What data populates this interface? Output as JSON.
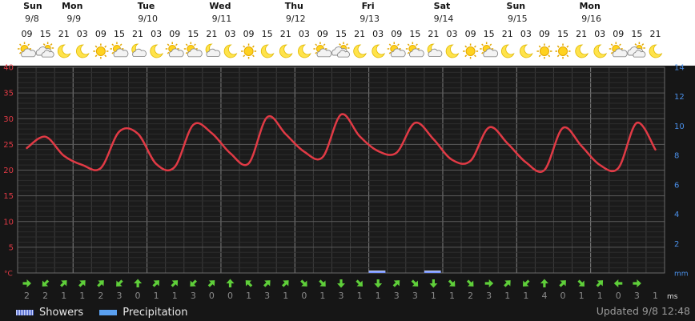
{
  "days": [
    {
      "weekday": "Sun",
      "date": "9/8"
    },
    {
      "weekday": "Mon",
      "date": "9/9"
    },
    {
      "weekday": "Tue",
      "date": "9/10"
    },
    {
      "weekday": "Wed",
      "date": "9/11"
    },
    {
      "weekday": "Thu",
      "date": "9/12"
    },
    {
      "weekday": "Fri",
      "date": "9/13"
    },
    {
      "weekday": "Sat",
      "date": "9/14"
    },
    {
      "weekday": "Sun",
      "date": "9/15"
    },
    {
      "weekday": "Mon",
      "date": "9/16"
    }
  ],
  "hours": [
    "09",
    "15",
    "21",
    "03",
    "09",
    "15",
    "21",
    "03",
    "09",
    "15",
    "21",
    "03",
    "09",
    "15",
    "21",
    "03",
    "09",
    "15",
    "21",
    "03",
    "09",
    "15",
    "21",
    "03",
    "09",
    "15",
    "21",
    "03",
    "09",
    "15",
    "21",
    "03",
    "09",
    "15",
    "21"
  ],
  "weather_icons": [
    "partly-cloudy-sun-icon",
    "partly-cloudy-icon",
    "moon-icon",
    "moon-icon",
    "sun-icon",
    "partly-cloudy-sun-icon",
    "partly-cloudy-moon-icon",
    "moon-icon",
    "partly-cloudy-sun-icon",
    "partly-cloudy-sun-icon",
    "partly-cloudy-moon-icon",
    "moon-icon",
    "sun-icon",
    "moon-icon",
    "moon-icon",
    "moon-icon",
    "partly-cloudy-sun-icon",
    "partly-cloudy-icon",
    "moon-icon",
    "moon-icon",
    "partly-cloudy-sun-icon",
    "partly-cloudy-sun-icon",
    "partly-cloudy-moon-icon",
    "moon-icon",
    "sun-icon",
    "partly-cloudy-sun-icon",
    "moon-icon",
    "moon-icon",
    "sun-icon",
    "sun-icon",
    "moon-icon",
    "moon-icon",
    "partly-cloudy-sun-icon",
    "partly-cloudy-icon",
    "moon-icon"
  ],
  "wind_dirs": [
    "E",
    "SW",
    "NE",
    "NE",
    "NE",
    "SW",
    "N",
    "NE",
    "NE",
    "SW",
    "NE",
    "N",
    "NW",
    "NE",
    "NE",
    "SE",
    "SE",
    "S",
    "SE",
    "S",
    "NE",
    "SE",
    "S",
    "SE",
    "SE",
    "E",
    "NE",
    "SW",
    "N",
    "NE",
    "SE",
    "NE",
    "W",
    "E"
  ],
  "wind_speeds": [
    "2",
    "2",
    "1",
    "1",
    "2",
    "3",
    "0",
    "1",
    "1",
    "3",
    "0",
    "0",
    "1",
    "3",
    "1",
    "0",
    "1",
    "3",
    "1",
    "1",
    "3",
    "3",
    "1",
    "1",
    "2",
    "3",
    "1",
    "1",
    "4",
    "0",
    "1",
    "1",
    "0",
    "3",
    "1"
  ],
  "units": {
    "temp": "°C",
    "precip": "mm",
    "wind": "ms"
  },
  "legend": {
    "showers": "Showers",
    "precipitation": "Precipitation"
  },
  "updated": "Updated 9/8 12:48",
  "colors": {
    "temperature": "#e03a45",
    "temp_axis": "#e03a45",
    "precip_axis": "#4a8fe8",
    "wind_arrow": "#5fcf3a"
  },
  "chart_data": {
    "type": "line",
    "title": "",
    "x": [
      "9/8 09",
      "9/8 15",
      "9/8 21",
      "9/9 03",
      "9/9 09",
      "9/9 15",
      "9/9 21",
      "9/10 03",
      "9/10 09",
      "9/10 15",
      "9/10 21",
      "9/11 03",
      "9/11 09",
      "9/11 15",
      "9/11 21",
      "9/12 03",
      "9/12 09",
      "9/12 15",
      "9/12 21",
      "9/13 03",
      "9/13 09",
      "9/13 15",
      "9/13 21",
      "9/14 03",
      "9/14 09",
      "9/14 15",
      "9/14 21",
      "9/15 03",
      "9/15 09",
      "9/15 15",
      "9/15 21",
      "9/16 03",
      "9/16 09",
      "9/16 15",
      "9/16 21"
    ],
    "series": [
      {
        "name": "Temperature",
        "axis": "left",
        "values": [
          24.3,
          26.5,
          22.8,
          21.0,
          20.4,
          27.5,
          27.1,
          21.2,
          20.6,
          28.8,
          27.2,
          23.3,
          21.3,
          30.3,
          27.0,
          23.6,
          22.5,
          30.8,
          26.6,
          23.7,
          23.4,
          29.2,
          26.0,
          22.0,
          21.8,
          28.3,
          25.2,
          21.5,
          20.0,
          28.2,
          24.7,
          21.0,
          20.4,
          29.2,
          24.0
        ]
      },
      {
        "name": "Showers",
        "axis": "right",
        "values": [
          0,
          0,
          0,
          0,
          0,
          0,
          0,
          0,
          0,
          0,
          0,
          0,
          0,
          0,
          0,
          0,
          0,
          0,
          0,
          0.1,
          0,
          0,
          0.1,
          0,
          0,
          0,
          0,
          0,
          0,
          0,
          0,
          0,
          0,
          0,
          0
        ]
      },
      {
        "name": "Precipitation",
        "axis": "right",
        "values": [
          0,
          0,
          0,
          0,
          0,
          0,
          0,
          0,
          0,
          0,
          0,
          0,
          0,
          0,
          0,
          0,
          0,
          0,
          0,
          0,
          0,
          0,
          0,
          0,
          0,
          0,
          0,
          0,
          0,
          0,
          0,
          0,
          0,
          0,
          0
        ]
      }
    ],
    "ylim_left": [
      0,
      40
    ],
    "yticks_left": [
      "40",
      "35",
      "30",
      "25",
      "20",
      "15",
      "10",
      "5"
    ],
    "ylim_right": [
      0,
      14
    ],
    "yticks_right": [
      "14",
      "12",
      "10",
      "8",
      "6",
      "4",
      "2"
    ],
    "grid": true,
    "legend_position": "bottom-left"
  }
}
